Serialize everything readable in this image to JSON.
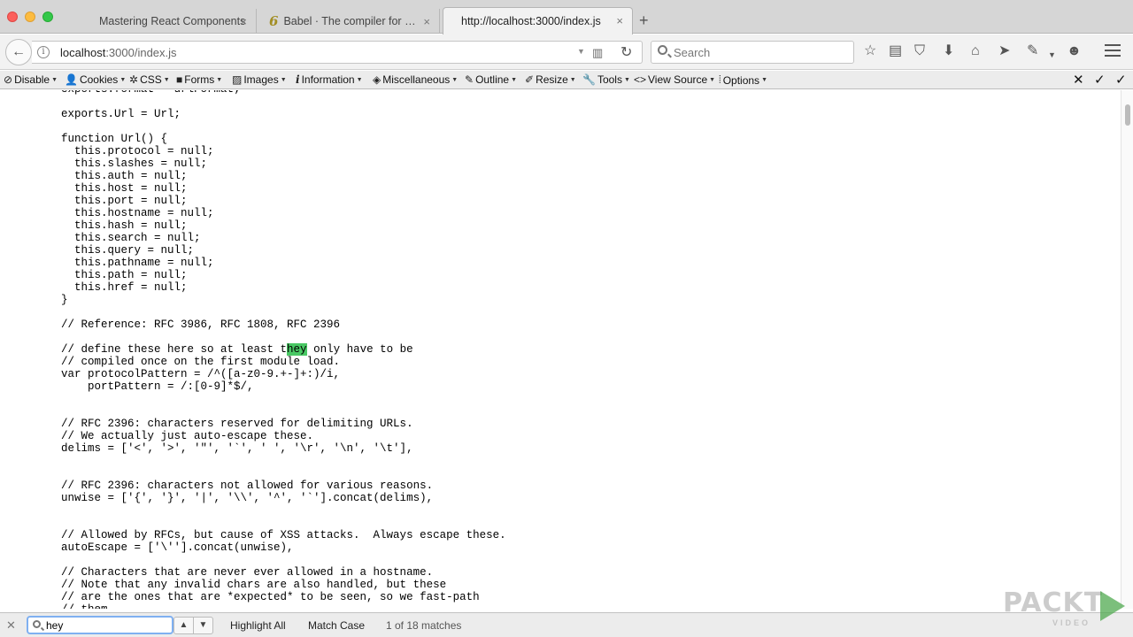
{
  "tabs": [
    {
      "label": "Mastering React Components",
      "active": false
    },
    {
      "label": "Babel · The compiler for writ…",
      "active": false,
      "icon_text": "6"
    },
    {
      "label": "http://localhost:3000/index.js",
      "active": true
    }
  ],
  "tab_close_glyph": "×",
  "new_tab_glyph": "+",
  "nav": {
    "url_host": "localhost",
    "url_rest": ":3000/index.js",
    "search_placeholder": "Search"
  },
  "devtoolbar": {
    "items": [
      "Disable",
      "Cookies",
      "CSS",
      "Forms",
      "Images",
      "Information",
      "Miscellaneous",
      "Outline",
      "Resize",
      "Tools",
      "View Source",
      "Options"
    ]
  },
  "code": {
    "lines": [
      "exports.format = urlFormat;",
      "",
      "exports.Url = Url;",
      "",
      "function Url() {",
      "  this.protocol = null;",
      "  this.slashes = null;",
      "  this.auth = null;",
      "  this.host = null;",
      "  this.port = null;",
      "  this.hostname = null;",
      "  this.hash = null;",
      "  this.search = null;",
      "  this.query = null;",
      "  this.pathname = null;",
      "  this.path = null;",
      "  this.href = null;",
      "}",
      "",
      "// Reference: RFC 3986, RFC 1808, RFC 2396",
      "",
      "// define these here so at least they only have to be",
      "// compiled once on the first module load.",
      "var protocolPattern = /^([a-z0-9.+-]+:)/i,",
      "    portPattern = /:[0-9]*$/,",
      "",
      "",
      "// RFC 2396: characters reserved for delimiting URLs.",
      "// We actually just auto-escape these.",
      "delims = ['<', '>', '\"', '`', ' ', '\\r', '\\n', '\\t'],",
      "",
      "",
      "// RFC 2396: characters not allowed for various reasons.",
      "unwise = ['{', '}', '|', '\\\\', '^', '`'].concat(delims),",
      "",
      "",
      "// Allowed by RFCs, but cause of XSS attacks.  Always escape these.",
      "autoEscape = ['\\''].concat(unwise),",
      "",
      "// Characters that are never ever allowed in a hostname.",
      "// Note that any invalid chars are also handled, but these",
      "// are the ones that are *expected* to be seen, so we fast-path",
      "// them."
    ],
    "highlight": {
      "line": 21,
      "term": "hey",
      "occurrence_prefix": "// define these here so at least t"
    }
  },
  "findbar": {
    "query": "hey",
    "highlight_all_label": "Highlight All",
    "match_case_label": "Match Case",
    "status": "1 of 18 matches"
  },
  "watermark": {
    "brand": "PACKT",
    "sub": "VIDEO"
  }
}
